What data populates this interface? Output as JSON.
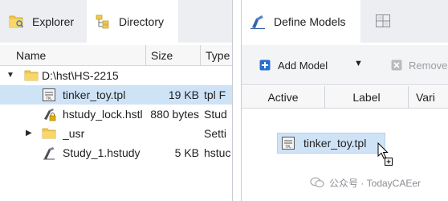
{
  "left_tabs": {
    "explorer_label": "Explorer",
    "directory_label": "Directory"
  },
  "columns": {
    "name": "Name",
    "size": "Size",
    "type": "Type"
  },
  "rows": [
    {
      "name": "D:\\hst\\HS-2215",
      "size": "",
      "type": "",
      "icon": "folder-icon",
      "expander": "expanded"
    },
    {
      "name": "tinker_toy.tpl",
      "size": "19 KB",
      "type": "tpl F",
      "icon": "tpl-file-icon",
      "selected": true
    },
    {
      "name": "hstudy_lock.hstl",
      "size": "880 bytes",
      "type": "Stud",
      "icon": "hstl-file-icon"
    },
    {
      "name": "_usr",
      "size": "",
      "type": "Setti",
      "icon": "folder-icon",
      "expander": "collapsed"
    },
    {
      "name": "Study_1.hstudy",
      "size": "5 KB",
      "type": "hstuc",
      "icon": "hstudy-file-icon"
    }
  ],
  "right_tabs": {
    "define_models_label": "Define Models"
  },
  "toolbar": {
    "add_model_label": "Add Model",
    "remove_label": "Remove"
  },
  "model_columns": {
    "active": "Active",
    "label": "Label",
    "var": "Vari"
  },
  "drag_item": {
    "label": "tinker_toy.tpl"
  },
  "watermark": {
    "text": "公众号 · TodayCAEer"
  },
  "colors": {
    "tab_bar": "#eceef1",
    "selection": "#cfe3f7",
    "accent_blue": "#2a6fd0",
    "folder_yellow": "#f2c94c"
  }
}
